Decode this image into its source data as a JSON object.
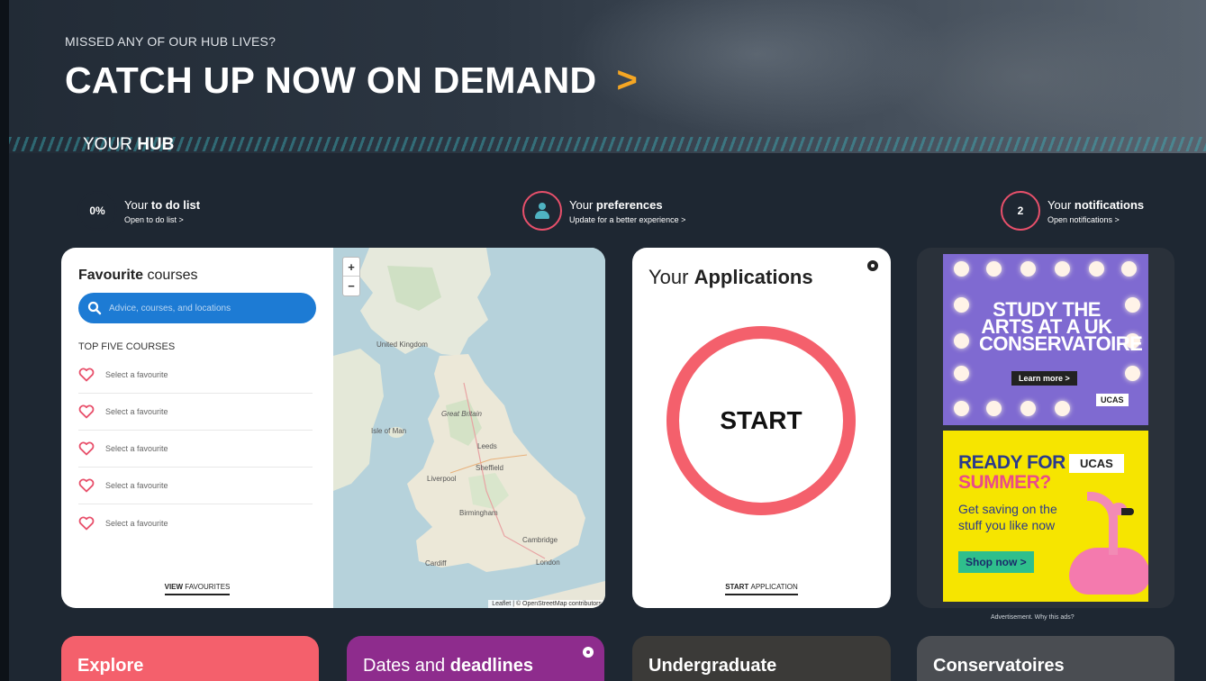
{
  "hero": {
    "kicker": "MISSED ANY OF OUR HUB LIVES?",
    "title": "CATCH UP NOW ON DEMAND",
    "arrow": ">"
  },
  "hub": {
    "prefix": "YOUR ",
    "bold": "HUB"
  },
  "stats": {
    "todo": {
      "ring": "0%",
      "prefix": "Your ",
      "bold": "to do list",
      "link": "Open to do list >"
    },
    "prefs": {
      "prefix": "Your ",
      "bold": "preferences",
      "link": "Update for a better experience >"
    },
    "notifs": {
      "ring": "2",
      "prefix": "Your ",
      "bold": "notifications",
      "link": "Open notifications >"
    }
  },
  "favourites": {
    "title_bold": "Favourite",
    "title_rest": " courses",
    "search_placeholder": "Advice, courses, and locations",
    "top_label": "TOP FIVE COURSES",
    "items": [
      "Select a favourite",
      "Select a favourite",
      "Select a favourite",
      "Select a favourite",
      "Select a favourite"
    ],
    "view_bold": "VIEW ",
    "view_rest": "FAVOURITES"
  },
  "map": {
    "zoom_in": "+",
    "zoom_out": "−",
    "labels": {
      "uk": "United Kingdom",
      "gb": "Great Britain",
      "iom": "Isle of Man",
      "leeds": "Leeds",
      "sheffield": "Sheffield",
      "liverpool": "Liverpool",
      "birmingham": "Birmingham",
      "cambridge": "Cambridge",
      "london": "London",
      "cardiff": "Cardiff"
    },
    "attribution": "Leaflet | © OpenStreetMap contributors"
  },
  "applications": {
    "title_prefix": "Your ",
    "title_bold": "Applications",
    "start": "START",
    "link_bold": "START ",
    "link_rest": "APPLICATION"
  },
  "ads": {
    "ad1": {
      "text": "STUDY THE ARTS AT A UK CONSERVATOIRE",
      "button": "Learn more >",
      "badge": "UCAS"
    },
    "ad2": {
      "line1": "READY FOR",
      "line2": "SUMMER?",
      "body": "Get saving on the stuff you like now",
      "button": "Shop now >",
      "badge": "UCAS"
    },
    "note": "Advertisement. Why this ads?"
  },
  "bottom_cards": {
    "explore": "Explore",
    "dates_prefix": "Dates and ",
    "dates_bold": "deadlines",
    "undergraduate": "Undergraduate",
    "conservatoires": "Conservatoires"
  },
  "colors": {
    "background": "#1e2732",
    "accent_orange": "#f5a623",
    "start_ring": "#f4606c",
    "search_blue": "#1d7bd4",
    "dates_purple": "#8e2c8d"
  }
}
